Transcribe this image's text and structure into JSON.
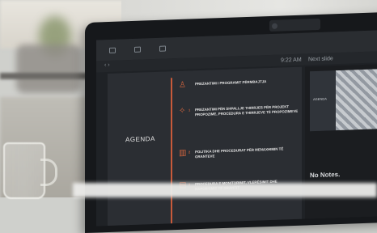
{
  "presenter": {
    "toolbar": {
      "item1": "",
      "item2": "",
      "item3": ""
    },
    "clock": "9:22 AM",
    "next_slide_label": "Next slide",
    "notes": "No Notes."
  },
  "slide": {
    "title": "AGENDA",
    "items": [
      {
        "num": "",
        "text": "PREZANTIMI I PROGRAMIT PËRMBAJTJA"
      },
      {
        "num": "1",
        "text": "PREZANTIMI PËR SHPALLJE THIRRJES PËR PROJEKT PROPOZIME, PROCEDURA E THIRRJEVE TË PROPOZIMEVE"
      },
      {
        "num": "2",
        "text": "POLITIKA DHE PROCEDURAT PËR MENAXHIMIN TË GRANTEVE"
      },
      {
        "num": "3",
        "text": "PROCEDURA E MONITORIMIT, VLERËSIMIT DHE RAPORTIMIT TË GRANTIT"
      }
    ]
  },
  "thumbnail": {
    "label": "AGENDA"
  },
  "icons": [
    "video-icon",
    "grid-icon",
    "microphone-icon",
    "arrows-icon"
  ]
}
